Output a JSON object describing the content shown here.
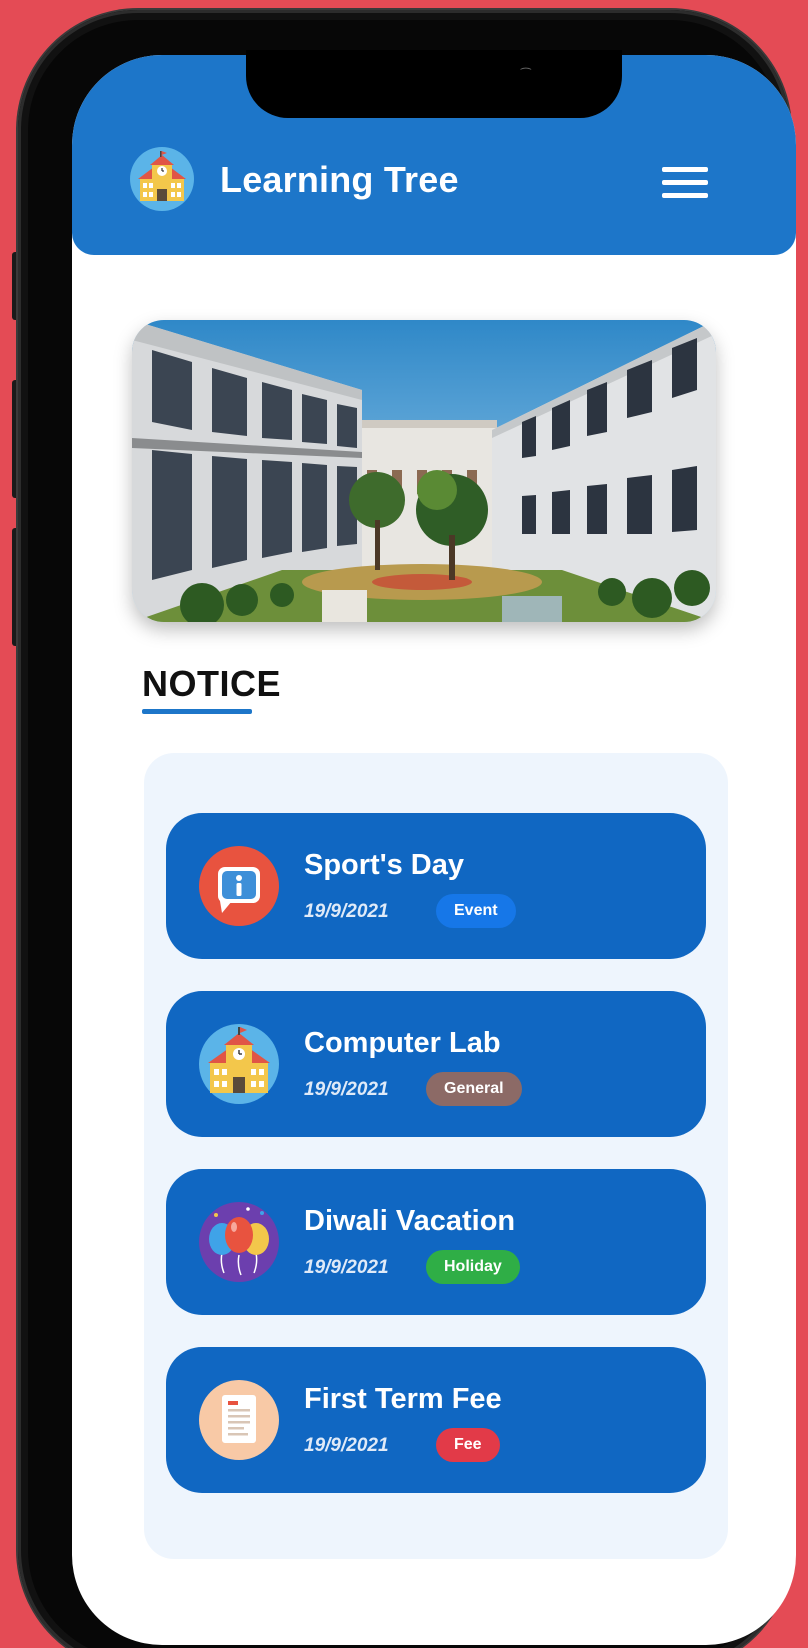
{
  "app": {
    "title": "Learning Tree",
    "logo_icon": "school-building-icon",
    "menu_icon": "hamburger-menu-icon"
  },
  "hero": {
    "image": "school-courtyard-photo"
  },
  "notice": {
    "heading": "NOTICE",
    "items": [
      {
        "title": "Sport's Day",
        "date": "19/9/2021",
        "tag": "Event",
        "tag_color": "#1677e8",
        "icon": "info-chat-icon"
      },
      {
        "title": "Computer Lab",
        "date": "19/9/2021",
        "tag": "General",
        "tag_color": "#8c6a66",
        "icon": "school-building-icon"
      },
      {
        "title": "Diwali Vacation",
        "date": "19/9/2021",
        "tag": "Holiday",
        "tag_color": "#2fae46",
        "icon": "balloons-icon"
      },
      {
        "title": "First Term Fee",
        "date": "19/9/2021",
        "tag": "Fee",
        "tag_color": "#e23a48",
        "icon": "fee-document-icon"
      }
    ]
  },
  "colors": {
    "primary": "#1d76c9",
    "card": "#1067c2",
    "background": "#e44b55"
  }
}
